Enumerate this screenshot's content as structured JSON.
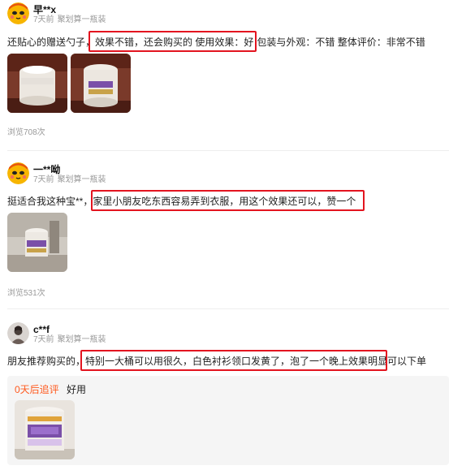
{
  "reviews": [
    {
      "username": "早**x",
      "time": "7天前",
      "sku": "聚划算一瓶装",
      "text_before": "还贴心的赠送勺子，",
      "text_highlight": "效果不错，还会购买的 使用效果：好",
      "text_after": "包装与外观：不错 整体评价：非常不错",
      "views": "浏览708次",
      "avatar_icon": "emoji-face-icon"
    },
    {
      "username": "一**呦",
      "time": "7天前",
      "sku": "聚划算一瓶装",
      "text_before": "挺适合我这种宝**，",
      "text_highlight": "家里小朋友吃东西容易弄到衣服，用这个效果还可以，赞一个",
      "text_after": "",
      "views": "浏览531次",
      "avatar_icon": "emoji-face-icon"
    },
    {
      "username": "c**f",
      "time": "7天前",
      "sku": "聚划算一瓶装",
      "text_before": "朋友推荐购买的，",
      "text_highlight": "特别一大桶可以用很久，白色衬衫领口发黄了，泡了一个晚上效果明显",
      "text_after": "可以下单",
      "followup_label": "0天后追评",
      "followup_text": "好用",
      "avatar_icon": "user-photo-icon"
    }
  ],
  "colors": {
    "highlight_border": "#e3141f",
    "followup_label": "#ff5a1f",
    "meta_text": "#999999"
  }
}
